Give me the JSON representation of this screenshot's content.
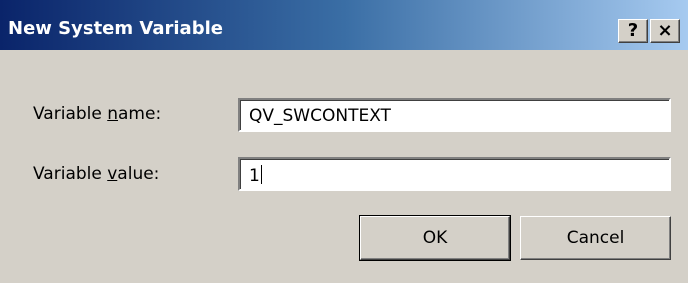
{
  "dialog": {
    "title": "New System Variable",
    "help_glyph": "?",
    "close_glyph": "×"
  },
  "form": {
    "name_label_prefix": "Variable ",
    "name_label_accel": "n",
    "name_label_suffix": "ame:",
    "name_value": "QV_SWCONTEXT",
    "value_label_prefix": "Variable ",
    "value_label_accel": "v",
    "value_label_suffix": "alue:",
    "value_value": "1"
  },
  "buttons": {
    "ok_label": "OK",
    "cancel_label": "Cancel"
  }
}
